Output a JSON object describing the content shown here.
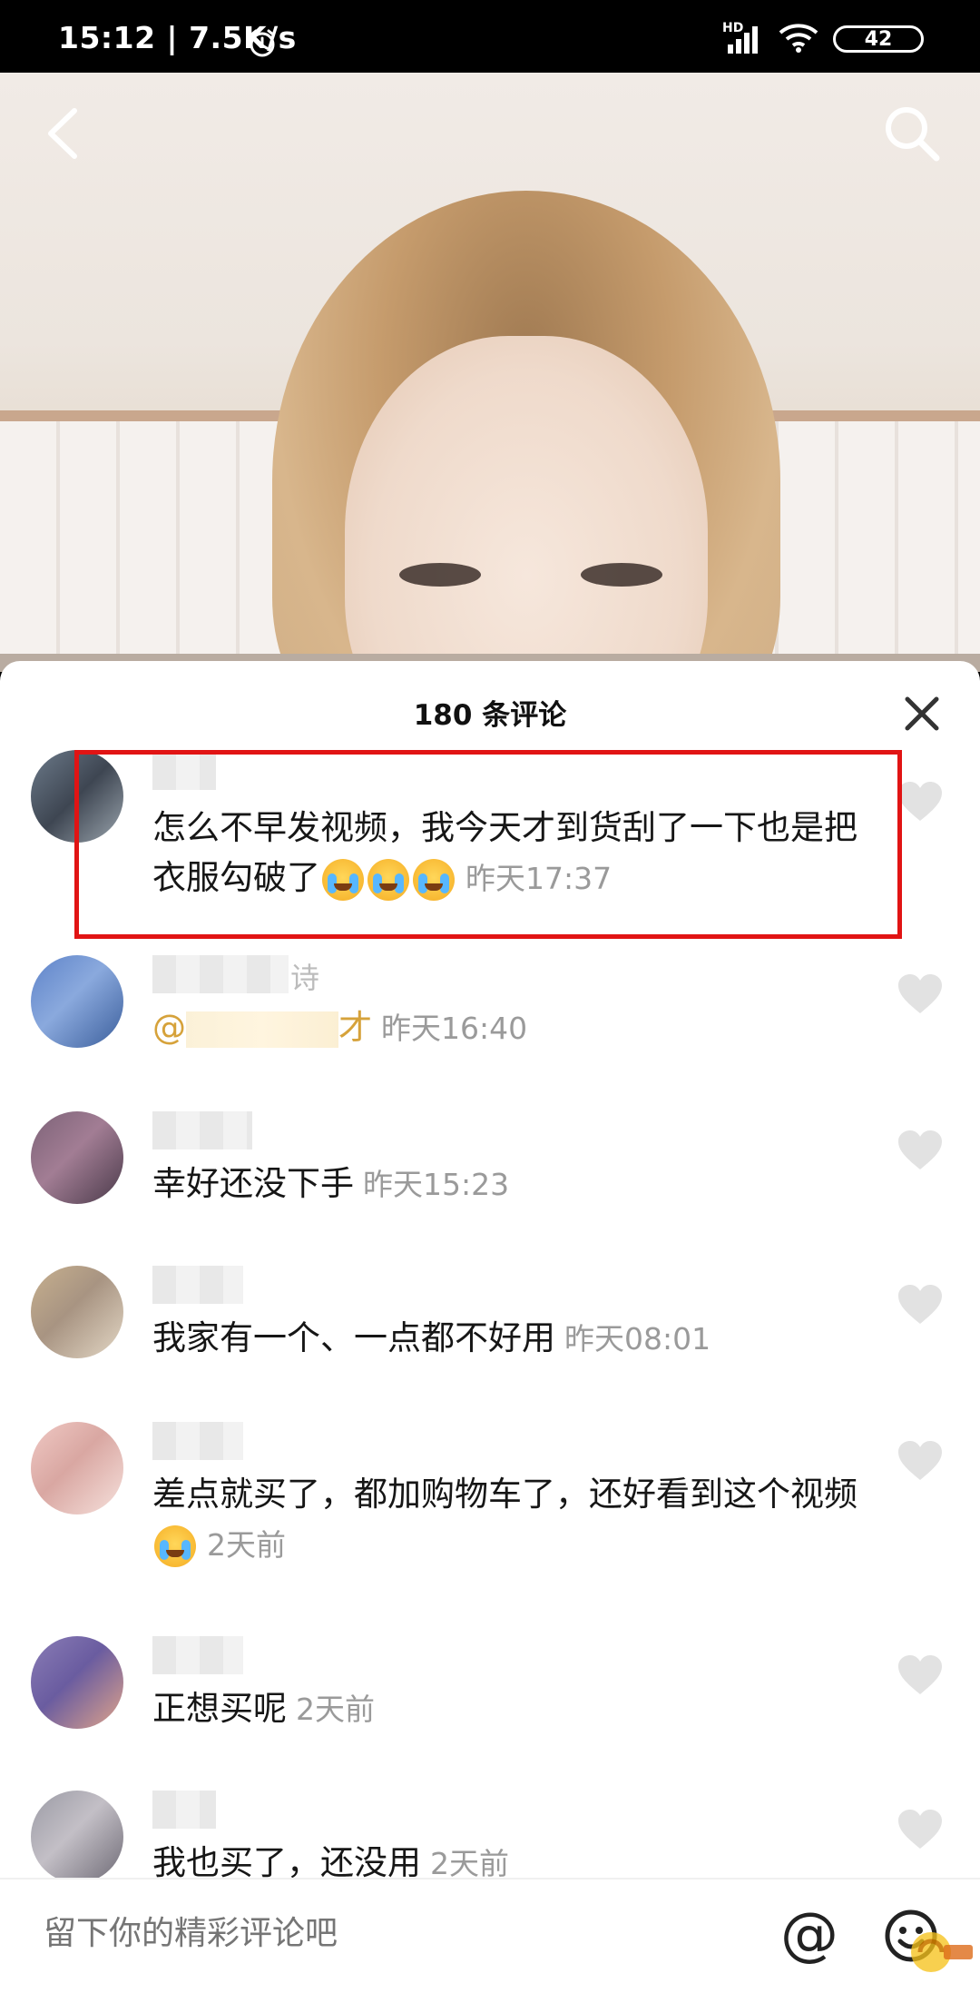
{
  "status_bar": {
    "time": "15:12 | 7.5K/s",
    "network_badge": "HD",
    "battery": "42",
    "icons": [
      "alarm-icon",
      "signal-icon",
      "wifi-icon",
      "battery-icon"
    ]
  },
  "video": {
    "icons": [
      "back-arrow-icon",
      "search-icon"
    ]
  },
  "comments_panel": {
    "title": "180 条评论",
    "close_icon": "close-icon",
    "comments": [
      {
        "text": "怎么不早发视频，我今天才到货刮了一下也是把衣服勾破了",
        "emoji": [
          "crying-emoji",
          "crying-emoji",
          "crying-emoji"
        ],
        "time": "昨天17:37",
        "highlighted": true
      },
      {
        "name_suffix": "诗",
        "mention_prefix": "@",
        "mention_suffix": "才",
        "time": "昨天16:40"
      },
      {
        "text": "幸好还没下手",
        "time": "昨天15:23"
      },
      {
        "text": "我家有一个、一点都不好用",
        "time": "昨天08:01"
      },
      {
        "text": "差点就买了，都加购物车了，还好看到这个视频",
        "emoji": [
          "rofl-emoji"
        ],
        "time": "2天前"
      },
      {
        "text": "正想买呢",
        "time": "2天前"
      },
      {
        "text": "我也买了，还没用",
        "time": "2天前"
      }
    ]
  },
  "input_bar": {
    "placeholder": "留下你的精彩评论吧",
    "at_label": "@",
    "icons": [
      "emoji-icon"
    ]
  },
  "colors": {
    "highlight_border": "#e11414",
    "mention": "#d6a23a",
    "timestamp": "#9a9a9a"
  }
}
